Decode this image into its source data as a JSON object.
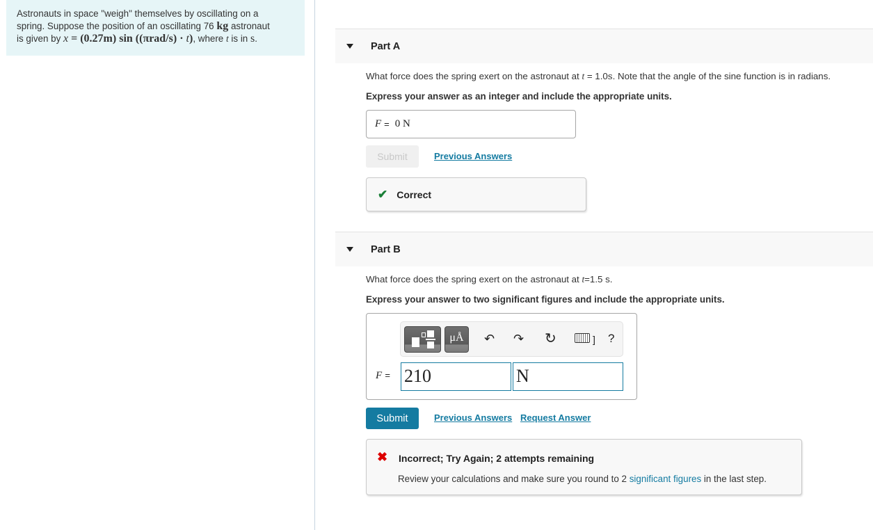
{
  "problem": {
    "text_1": "Astronauts in space \"weigh\" themselves by oscillating on a",
    "text_2a": "spring. Suppose the position of an oscillating 76 ",
    "mass_unit": "kg",
    "text_2b": " astronaut",
    "text_3a": "is given by ",
    "equation_var": "x",
    "equation": " = (0.27m)  sin ((πrad/s) · ",
    "equation_t": "t",
    "equation_close": ")",
    "text_3b": ", where ",
    "t_var": "t",
    "text_3c": " is in ",
    "time_unit": "s",
    "text_3d": "."
  },
  "part_a": {
    "title": "Part A",
    "question_pre": "What force does the spring exert on the astronaut at ",
    "question_var": "t",
    "question_mid": " = 1.0",
    "question_unit": "s",
    "question_post": ". Note that the angle of the sine function is in radians.",
    "instruction": "Express your answer as an integer and include the appropriate units.",
    "answer_var": "F",
    "answer_eq": "=",
    "answer_value": "0 N",
    "submit_label": "Submit",
    "previous_answers": "Previous Answers",
    "feedback_icon": "check-icon",
    "feedback": "Correct",
    "feedback_color": "#1a7f37"
  },
  "part_b": {
    "title": "Part B",
    "question_pre": "What force does the spring exert on the astronaut at ",
    "question_var": "t",
    "question_post": "=1.5 s.",
    "instruction": "Express your answer to two significant figures and include the appropriate units.",
    "toolbar": {
      "templates_icon": "templates-icon",
      "units_label": "μÅ",
      "undo_icon": "undo-icon",
      "redo_icon": "redo-icon",
      "reset_icon": "reset-icon",
      "keyboard_icon": "keyboard-icon",
      "help_label": "?"
    },
    "answer_var": "F",
    "answer_eq": "=",
    "value": "210",
    "unit": "N",
    "submit_label": "Submit",
    "previous_answers": "Previous Answers",
    "request_answer": "Request Answer",
    "feedback_icon": "x-icon",
    "feedback_title": "Incorrect; Try Again; 2 attempts remaining",
    "feedback_pre": "Review your calculations and make sure you round to 2 ",
    "feedback_link": "significant figures",
    "feedback_post": " in the last step.",
    "feedback_color": "#dd0000"
  },
  "colors": {
    "accent": "#147ba1",
    "intro_bg": "#e6f5f7",
    "header_bg": "#f8f8f8"
  }
}
